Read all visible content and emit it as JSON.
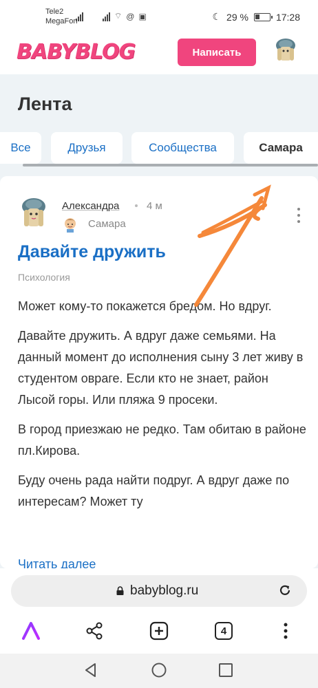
{
  "status_bar": {
    "carrier1": "Tele2",
    "carrier2": "MegaFon",
    "battery_percent": "29 %",
    "time": "17:28"
  },
  "header": {
    "logo": "BABYBLOG",
    "write_button": "Написать"
  },
  "feed": {
    "title": "Лента",
    "tabs": [
      "Все",
      "Друзья",
      "Сообщества",
      "Самара"
    ],
    "active_tab": "Самара"
  },
  "post": {
    "author": "Александра",
    "time": "4 м",
    "community": "Самара",
    "title": "Давайте дружить",
    "category": "Психология",
    "paragraphs": [
      "Может кому-то покажется бредом. Но вдруг.",
      "Давайте дружить. А вдруг даже семьями. На данный момент до исполнения сыну 3 лет живу в студентом овраге. Если кто не знает, район Лысой горы. Или пляжа 9 просеки.",
      "В город приезжаю не редко. Там обитаю в районе пл.Кирова.",
      "Буду очень рада найти подруг. А вдруг даже по интересам? Может ту"
    ],
    "read_more": "Читать далее"
  },
  "browser": {
    "url": "babyblog.ru",
    "tab_count": "4"
  },
  "colors": {
    "brand_pink": "#f0457e",
    "link_blue": "#1a6fc5",
    "scribble_orange": "#f5883a"
  }
}
